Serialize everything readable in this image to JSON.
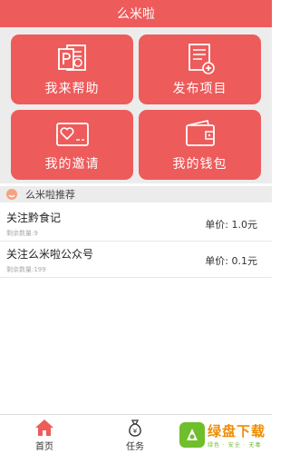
{
  "header": {
    "title": "么米啦"
  },
  "tiles": [
    {
      "label": "我来帮助",
      "icon": "powerpoint-icon"
    },
    {
      "label": "发布项目",
      "icon": "document-add-icon"
    },
    {
      "label": "我的邀请",
      "icon": "heart-card-icon"
    },
    {
      "label": "我的钱包",
      "icon": "wallet-icon"
    }
  ],
  "recommend": {
    "title": "么米啦推荐",
    "icon": "smile-icon"
  },
  "tasks": [
    {
      "title": "关注黔食记",
      "remaining": "剩余数量:9",
      "price": "单价: 1.0元"
    },
    {
      "title": "关注么米啦公众号",
      "remaining": "剩余数量:199",
      "price": "单价: 0.1元"
    }
  ],
  "tabbar": {
    "items": [
      {
        "label": "首页",
        "icon": "home-icon"
      },
      {
        "label": "任务",
        "icon": "money-bag-icon"
      }
    ]
  },
  "watermark": {
    "main": "绿盘下载",
    "sub": "绿色 · 安全 · 无毒"
  },
  "colors": {
    "accent": "#ee5b5b",
    "background": "#ececec",
    "watermark_green": "#6fbe2c",
    "watermark_orange": "#f08c00"
  }
}
